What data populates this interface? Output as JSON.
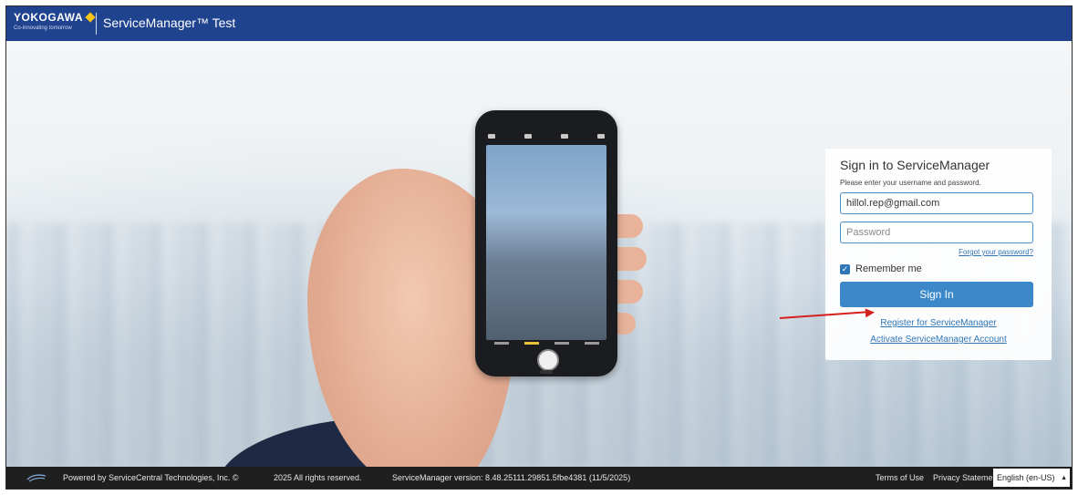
{
  "header": {
    "brand": "YOKOGAWA",
    "tagline": "Co-innovating tomorrow",
    "app_title": "ServiceManager™ Test"
  },
  "login": {
    "title": "Sign in to ServiceManager",
    "subtitle": "Please enter your username and password.",
    "username_value": "hillol.rep@gmail.com",
    "password_placeholder": "Password",
    "forgot_label": "Forgot your password?",
    "remember_label": "Remember me",
    "remember_checked": true,
    "signin_label": "Sign In",
    "register_label": "Register for ServiceManager",
    "activate_label": "Activate ServiceManager Account"
  },
  "footer": {
    "powered_by": "Powered by ServiceCentral Technologies, Inc. ©",
    "rights": "2025  All rights reserved.",
    "version": "ServiceManager version: 8.48.25111.29851.5fbe4381 (11/5/2025)",
    "terms_label": "Terms of Use",
    "privacy_label": "Privacy Statement",
    "language": "English (en-US)"
  },
  "colors": {
    "header_bg": "#20438f",
    "accent": "#3d88c9",
    "link": "#2f76b6",
    "annotation_arrow": "#d62020",
    "footer_bg": "#1f1f1f"
  },
  "icons": {
    "brand_mark": "yokogawa-diamond-icon",
    "footer_mark": "servicecentral-swoosh-icon",
    "checkbox": "checkmark-icon",
    "language_caret": "caret-up-icon"
  }
}
